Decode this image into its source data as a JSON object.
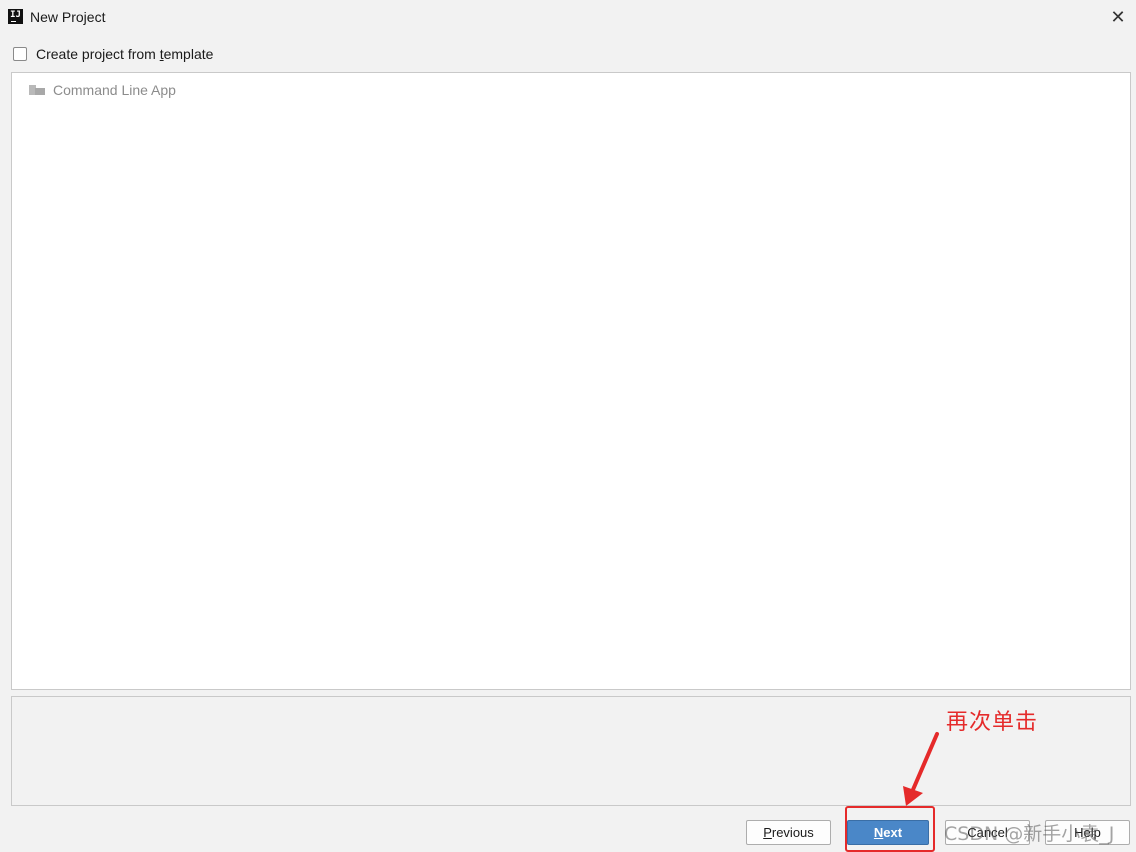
{
  "window": {
    "title": "New Project",
    "close_glyph": "✕",
    "logo_text": "IJ"
  },
  "template_option": {
    "checkbox_checked": false,
    "label_pre": "Create project from ",
    "label_mnemonic": "t",
    "label_post": "emplate"
  },
  "template_list": {
    "items": [
      {
        "label": "Command Line App",
        "icon": "folder-icon",
        "enabled": false
      }
    ]
  },
  "buttons": {
    "previous_mnemonic": "P",
    "previous_rest": "revious",
    "next_mnemonic": "N",
    "next_rest": "ext",
    "cancel_label": "Cancel",
    "help_label": "Help"
  },
  "annotation": {
    "text": "再次单击",
    "color": "#e52a2a"
  },
  "watermark": {
    "text": "CSDN @新手小袁_J"
  },
  "colors": {
    "next_button": "#4a87c8",
    "window_bg": "#f2f2f2",
    "annotation_red": "#e52a2a"
  }
}
